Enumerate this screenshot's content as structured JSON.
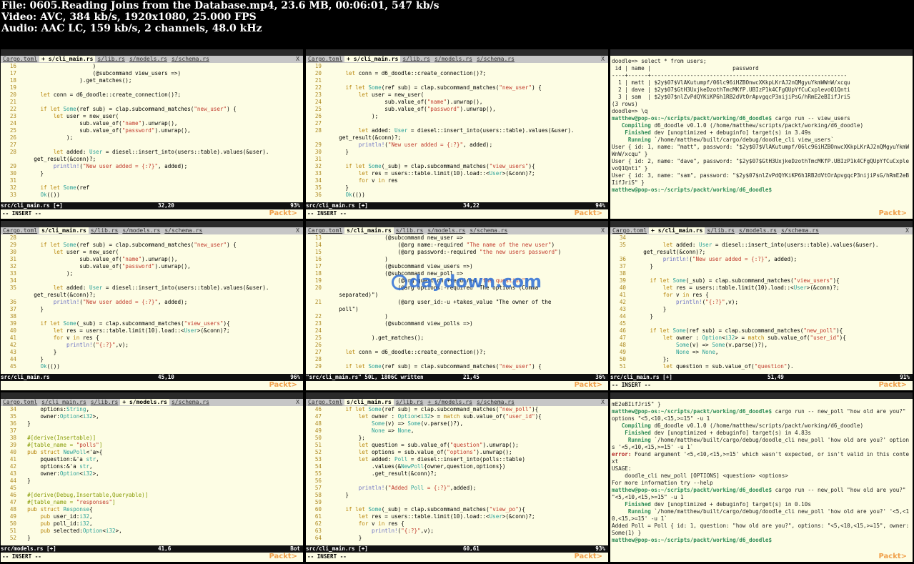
{
  "header": {
    "line1": "File: 0605.Reading Joins from the Database.mp4, 23.6 MB, 00:06:01, 547 kb/s",
    "line2": "Video: AVC, 384 kb/s, 1920x1080, 25.000 FPS",
    "line3": "Audio: AAC LC, 159 kb/s, 2 channels, 48.0 kHz"
  },
  "watermark": "daydown.com",
  "logo": "Packt>",
  "panes": [
    {
      "tabs": [
        "Cargo.toml",
        "+ s/cli_main.rs",
        "s/lib.rs",
        "s/models.rs",
        "s/schema.rs"
      ],
      "active": 1,
      "status": {
        "file": "src/cli_main.rs [+]",
        "pos": "32,20",
        "pct": "93%"
      },
      "mode": "-- INSERT --",
      "lines": [
        "16                      )",
        "17                      (@subcommand view_users =>)",
        "18                  ).get_matches();",
        "19",
        "20      let conn = d6_doodle::create_connection()?;",
        "21",
        "22      if let Some(ref sub) = clap.subcommand_matches(\"new_user\") {",
        "23          let user = new_user(",
        "24                  sub.value_of(\"name\").unwrap(),",
        "25                  sub.value_of(\"password\").unwrap(),",
        "26              );",
        "27",
        "28          let added: User = diesel::insert_into(users::table).values(&user).",
        "    get_result(&conn)?;",
        "29          println!(\"New user added = {:?}\", added);",
        "30      }",
        "31",
        "32      if let Some(ref",
        "33      Ok(())"
      ]
    },
    {
      "tabs": [
        "Cargo.toml",
        "+ s/cli_main.rs",
        "s/lib.rs",
        "s/models.rs",
        "s/schema.rs"
      ],
      "active": 1,
      "status": {
        "file": "src/cli_main.rs [+]",
        "pos": "34,22",
        "pct": "94%"
      },
      "mode": "-- INSERT --",
      "lines": [
        "19",
        "20      let conn = d6_doodle::create_connection()?;",
        "21",
        "22      if let Some(ref sub) = clap.subcommand_matches(\"new_user\") {",
        "23          let user = new_user(",
        "24                  sub.value_of(\"name\").unwrap(),",
        "25                  sub.value_of(\"password\").unwrap(),",
        "26              );",
        "27",
        "28          let added: User = diesel::insert_into(users::table).values(&user).",
        "    get_result(&conn)?;",
        "29          println!(\"New user added = {:?}\", added);",
        "30      }",
        "31",
        "32      if let Some(_sub) = clap.subcommand_matches(\"view_users\"){",
        "33          let res = users::table.limit(10).load::<User>(&conn)?;",
        "34          for v in res",
        "35      }",
        "36      Ok(())"
      ]
    },
    {
      "tabs": [],
      "active": -1,
      "status": null,
      "mode": "",
      "term": [
        "doodle=> select * from users;",
        " id | name |                         password",
        "----+------+------------------------------------------------------------",
        "  1 | matt | $2y$07$VlAKutumpf/06lc96iHZBOnwcXKkpLKrAJ2nQMgyuYkmWWnW/xcqu",
        "  2 | dave | $2y$07$GtH3UxjkeDzothTmcMKfP.UBIzP1k4CFgQUpYfCuCxplevoQ1Qnti",
        "  3 | sam  | $2y$07$nlZvPdQYKiKP6h1RB2dVtOrApvgqcP3nijiPsG/hRmE2eBIifJriS",
        "(3 rows)",
        "",
        "doodle=> \\q",
        "matthew@pop-os:~/scripts/packt/working/d6_doodle$ cargo run -- view_users",
        "   Compiling d6_doodle v0.1.0 (/home/matthew/scripts/packt/working/d6_doodle)",
        "    Finished dev [unoptimized + debuginfo] target(s) in 3.49s",
        "     Running `/home/matthew/built/cargo/debug/doodle_cli view_users`",
        "User { id: 1, name: \"matt\", password: \"$2y$07$VlAKutumpf/06lc96iHZBOnwcXKkpLKrAJ2nQMgyuYkmWWnW/xcqu\" }",
        "User { id: 2, name: \"dave\", password: \"$2y$07$GtH3UxjkeDzothTmcMKfP.UBIzP1k4CFgQUpYfCuCxplevoQ1Qnti\" }",
        "User { id: 3, name: \"sam\", password: \"$2y$07$nlZvPdQYKiKP6h1RB2dVtOrApvgqcP3nijiPsG/hRmE2eBIifJriS\" }",
        "matthew@pop-os:~/scripts/packt/working/d6_doodle$"
      ]
    },
    {
      "tabs": [
        "Cargo.toml",
        "s/cli_main.rs",
        "s/lib.rs",
        "s/models.rs",
        "s/schema.rs"
      ],
      "active": 1,
      "status": {
        "file": "src/cli_main.rs",
        "pos": "45,10",
        "pct": "96%"
      },
      "mode": "",
      "lines": [
        "28",
        "29      if let Some(ref sub) = clap.subcommand_matches(\"new_user\") {",
        "30          let user = new_user(",
        "31                  sub.value_of(\"name\").unwrap(),",
        "32                  sub.value_of(\"password\").unwrap(),",
        "33              );",
        "34",
        "35          let added: User = diesel::insert_into(users::table).values(&user).",
        "    get_result(&conn)?;",
        "36          println!(\"New user added = {:?}\", added);",
        "37      }",
        "38",
        "39      if let Some(_sub) = clap.subcommand_matches(\"view_users\"){",
        "40          let res = users::table.limit(10).load::<User>(&conn)?;",
        "41          for v in res {",
        "42              println!(\"{:?}\",v);",
        "43          }",
        "44      }",
        "45      Ok(())"
      ]
    },
    {
      "tabs": [
        "Cargo.toml",
        "s/cli_main.rs",
        "s/lib.rs",
        "s/models.rs",
        "s/schema.rs"
      ],
      "active": 1,
      "status": {
        "file": "\"src/cli_main.rs\" 50L, 1806C written",
        "pos": "21,45",
        "pct": "36%"
      },
      "mode": "",
      "lines": [
        "13                  (@subcommand new_user =>",
        "14                      (@arg name:-required \"The name of the new user\")",
        "15                      (@arg password:-required \"the new users password\")",
        "16                  )",
        "17                  (@subcommand view_users =>)",
        "18                  (@subcommand new_poll =>",
        "19                      (@arg question:+required \"the question\")",
        "20                      (@arg options:-required \"The options (Comma",
        "    separated)\")",
        "21                      (@arg user_id:-u +takes_value \"The owner of the",
        "    poll\")",
        "22                  )",
        "23                  (@subcommand view_polls =>)",
        "24",
        "25              ).get_matches();",
        "26",
        "27      let conn = d6_doodle::create_connection()?;",
        "28",
        "29      if let Some(ref sub) = clap.subcommand_matches(\"new_user\") {"
      ]
    },
    {
      "tabs": [
        "Cargo.toml",
        "+ s/cli_main.rs",
        "s/lib.rs",
        "s/models.rs",
        "s/schema.rs"
      ],
      "active": 1,
      "status": {
        "file": "src/cli_main.rs [+]",
        "pos": "51,49",
        "pct": "91%"
      },
      "mode": "-- INSERT --",
      "lines": [
        "34",
        "35          let added: User = diesel::insert_into(users::table).values(&user).",
        "    get_result(&conn)?;",
        "36          println!(\"New user added = {:?}\", added);",
        "37      }",
        "38",
        "39      if let Some(_sub) = clap.subcommand_matches(\"view_users\"){",
        "40          let res = users::table.limit(10).load::<User>(&conn)?;",
        "41          for v in res {",
        "42              println!(\"{:?}\",v);",
        "43          }",
        "44      }",
        "45",
        "46      if let Some(ref sub) = clap.subcommand_matches(\"new_poll\"){",
        "47          let owner : Option<i32> = match sub.value_of(\"user_id\"){",
        "48              Some(v) => Some(v.parse()?),",
        "49              None => None,",
        "50          };",
        "51          let question = sub.value_of(\"question\")."
      ]
    },
    {
      "tabs": [
        "Cargo.toml",
        "s/cli_main.rs",
        "s/lib.rs",
        "+ s/models.rs",
        "s/schema.rs"
      ],
      "active": 3,
      "status": {
        "file": "src/models.rs [+]",
        "pos": "41,6",
        "pct": "Bot"
      },
      "mode": "-- INSERT --",
      "lines": [
        "34      options:String,",
        "35      owner:Option<i32>,",
        "36  }",
        "37",
        "38  #[derive(Insertable)]",
        "39  #[table_name = \"polls\"]",
        "40  pub struct NewPoll<'a>{",
        "41      pquestion:&'a str,",
        "42      options:&'a str,",
        "43      owner:Option<i32>,",
        "44  }",
        "45",
        "46  #[derive(Debug,Insertable,Queryable)]",
        "47  #[table_name = \"responses\"]",
        "48  pub struct Response{",
        "49      pub user_id:i32,",
        "50      pub poll_id:i32,",
        "51      pub selected:Option<i32>,",
        "52  }"
      ]
    },
    {
      "tabs": [
        "Cargo.toml",
        "s/cli_main.rs",
        "s/lib.rs",
        "+ s/models.rs",
        "s/schema.rs"
      ],
      "active": 1,
      "status": {
        "file": "src/cli_main.rs [+]",
        "pos": "60,61",
        "pct": "93%"
      },
      "mode": "-- INSERT --",
      "lines": [
        "46      if let Some(ref sub) = clap.subcommand_matches(\"new_poll\"){",
        "47          let owner : Option<i32> = match sub.value_of(\"user_id\"){",
        "48              Some(v) => Some(v.parse()?),",
        "49              None => None,",
        "50          };",
        "51          let question = sub.value_of(\"question\").unwrap();",
        "52          let options = sub.value_of(\"options\").unwrap();",
        "53          let added: Poll = diesel::insert_into(polls::table)",
        "54              .values(&NewPoll{owner,question,options})",
        "55              .get_result(&conn)?;",
        "56",
        "57          println!(\"Added Poll = {:?}\",added);",
        "58      }",
        "59",
        "60      if let Some(_sub) = clap.subcommand_matches(\"view_po\"){",
        "61          let res = users::table.limit(10).load::<User>(&conn)?;",
        "62          for v in res {",
        "63              println!(\"{:?}\",v);",
        "64          }"
      ]
    },
    {
      "tabs": [],
      "active": -1,
      "status": null,
      "mode": "",
      "term": [
        "mE2eBIifJriS\" }",
        "matthew@pop-os:~/scripts/packt/working/d6_doodle$ cargo run -- new_poll \"how old are you?\" options \"<5,<10,<15,>=15\" -u 1",
        "   Compiling d6_doodle v0.1.0 (/home/matthew/scripts/packt/working/d6_doodle)",
        "    Finished dev [unoptimized + debuginfo] target(s) in 4.83s",
        "     Running `/home/matthew/built/cargo/debug/doodle_cli new_poll 'how old are you?' options '<5,<10,<15,>=15' -u 1`",
        "error: Found argument '<5,<10,<15,>=15' which wasn't expected, or isn't valid in this context",
        "",
        "USAGE:",
        "    doodle_cli new_poll [OPTIONS] <question> <options>",
        "",
        "For more information try --help",
        "matthew@pop-os:~/scripts/packt/working/d6_doodle$ cargo run -- new_poll \"how old are you?\" \"<5,<10,<15,>=15\" -u 1",
        "    Finished dev [unoptimized + debuginfo] target(s) in 0.10s",
        "     Running `/home/matthew/built/cargo/debug/doodle_cli new_poll 'how old are you?' '<5,<10,<15,>=15' -u 1`",
        "Added Poll = Poll { id: 1, question: \"how old are you?\", options: \"<5,<10,<15,>=15\", owner: Some(1) }",
        "matthew@pop-os:~/scripts/packt/working/d6_doodle$"
      ]
    }
  ]
}
